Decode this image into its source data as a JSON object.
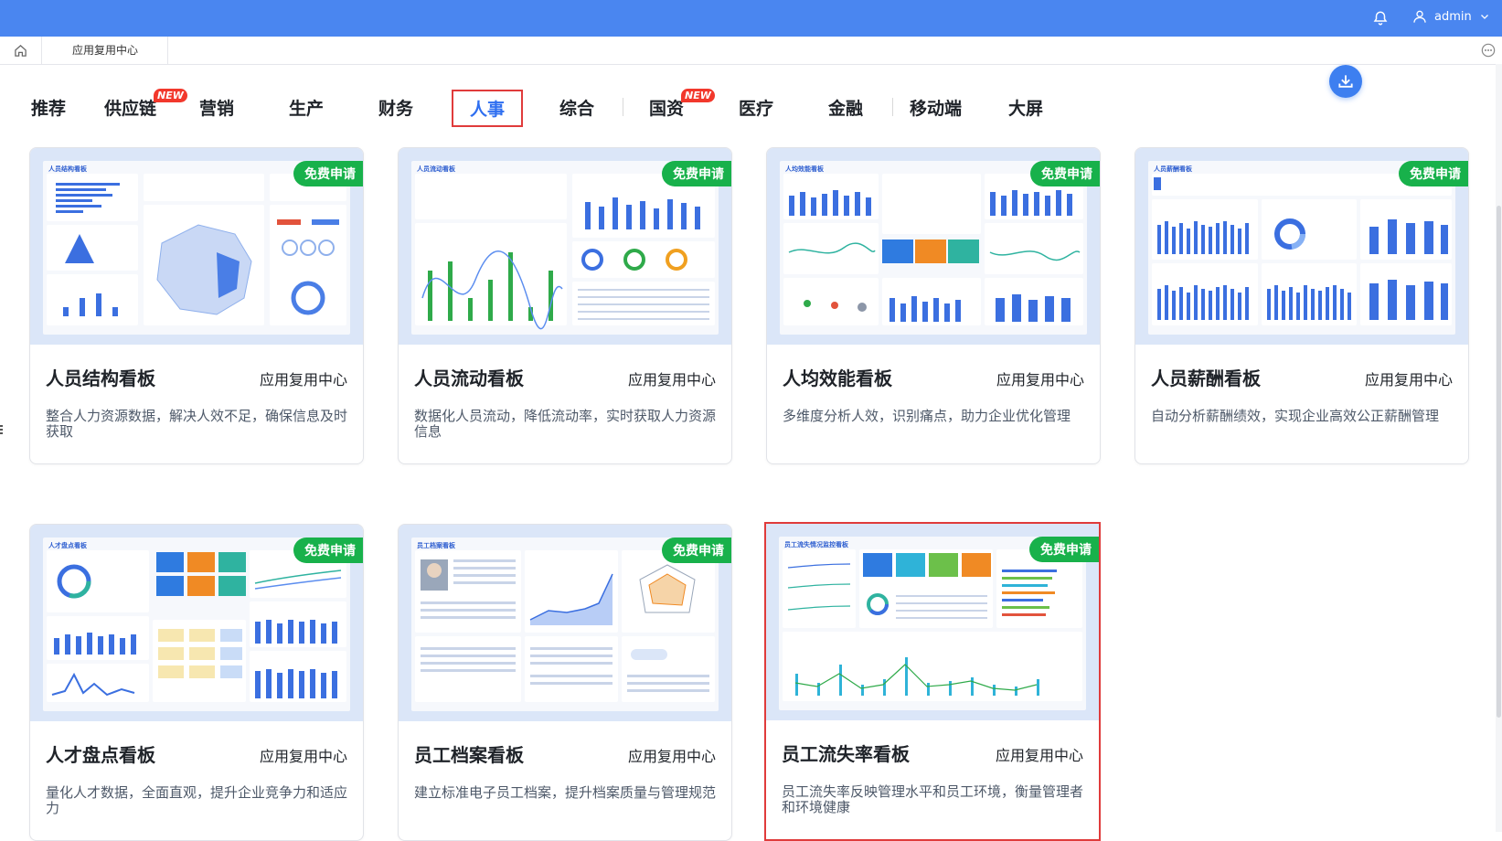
{
  "header": {
    "user_name": "admin",
    "bell_icon": "bell-icon",
    "user_icon": "user-icon",
    "brand_color": "#4a86f0"
  },
  "tabs": {
    "current_tab": "应用复用中心"
  },
  "categories": [
    {
      "label": "推荐"
    },
    {
      "label": "供应链",
      "badge": "NEW"
    },
    {
      "label": "营销"
    },
    {
      "label": "生产"
    },
    {
      "label": "财务"
    },
    {
      "label": "人事",
      "active": true
    },
    {
      "label": "综合"
    },
    {
      "label": "国资",
      "badge": "NEW"
    },
    {
      "label": "医疗"
    },
    {
      "label": "金融"
    },
    {
      "label": "移动端"
    },
    {
      "label": "大屏"
    }
  ],
  "cards": [
    {
      "title": "人员结构看板",
      "source": "应用复用中心",
      "badge": "免费申请",
      "desc": "整合人力资源数据，解决人效不足，确保信息及时获取",
      "thumb_title": "人员结构看板"
    },
    {
      "title": "人员流动看板",
      "source": "应用复用中心",
      "badge": "免费申请",
      "desc": "数据化人员流动，降低流动率，实时获取人力资源信息",
      "thumb_title": "人员流动看板"
    },
    {
      "title": "人均效能看板",
      "source": "应用复用中心",
      "badge": "免费申请",
      "desc": "多维度分析人效，识别痛点，助力企业优化管理",
      "thumb_title": "人均效能看板"
    },
    {
      "title": "人员薪酬看板",
      "source": "应用复用中心",
      "badge": "免费申请",
      "desc": "自动分析薪酬绩效，实现企业高效公正薪酬管理",
      "thumb_title": "人员薪酬看板"
    },
    {
      "title": "人才盘点看板",
      "source": "应用复用中心",
      "badge": "免费申请",
      "desc": "量化人才数据，全面直观，提升企业竞争力和适应力",
      "thumb_title": "人才盘点看板"
    },
    {
      "title": "员工档案看板",
      "source": "应用复用中心",
      "badge": "免费申请",
      "desc": "建立标准电子员工档案，提升档案质量与管理规范",
      "thumb_title": "员工档案看板"
    },
    {
      "title": "员工流失率看板",
      "source": "应用复用中心",
      "badge": "免费申请",
      "desc": "员工流失率反映管理水平和员工环境，衡量管理者和环境健康",
      "thumb_title": "员工流失情况监控看板",
      "selected": true
    }
  ]
}
